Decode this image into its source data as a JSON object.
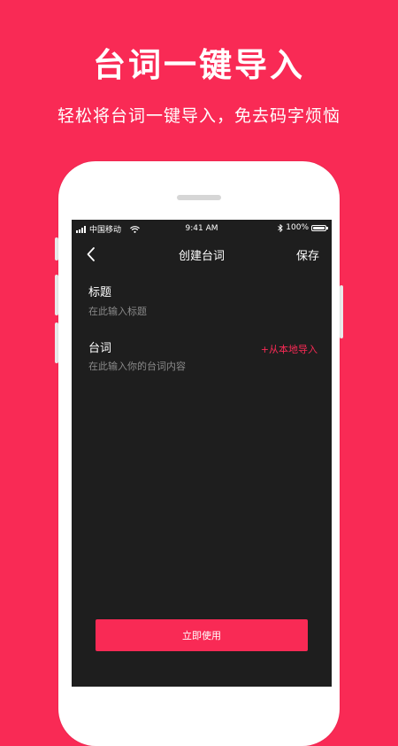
{
  "promo": {
    "headline": "台词一键导入",
    "subline": "轻松将台词一键导入，免去码字烦恼"
  },
  "status_bar": {
    "carrier": "中国移动",
    "time": "9:41 AM",
    "battery": "100%"
  },
  "nav": {
    "back_icon": "chevron-left-icon",
    "title": "创建台词",
    "save_label": "保存"
  },
  "form": {
    "title_label": "标题",
    "title_placeholder": "在此输入标题",
    "lines_label": "台词",
    "lines_placeholder": "在此输入你的台词内容",
    "import_label": "+从本地导入"
  },
  "actions": {
    "use_label": "立即使用"
  },
  "colors": {
    "accent": "#f92a55",
    "screen_bg": "#1e1e1e",
    "placeholder": "#8a8a8a"
  }
}
